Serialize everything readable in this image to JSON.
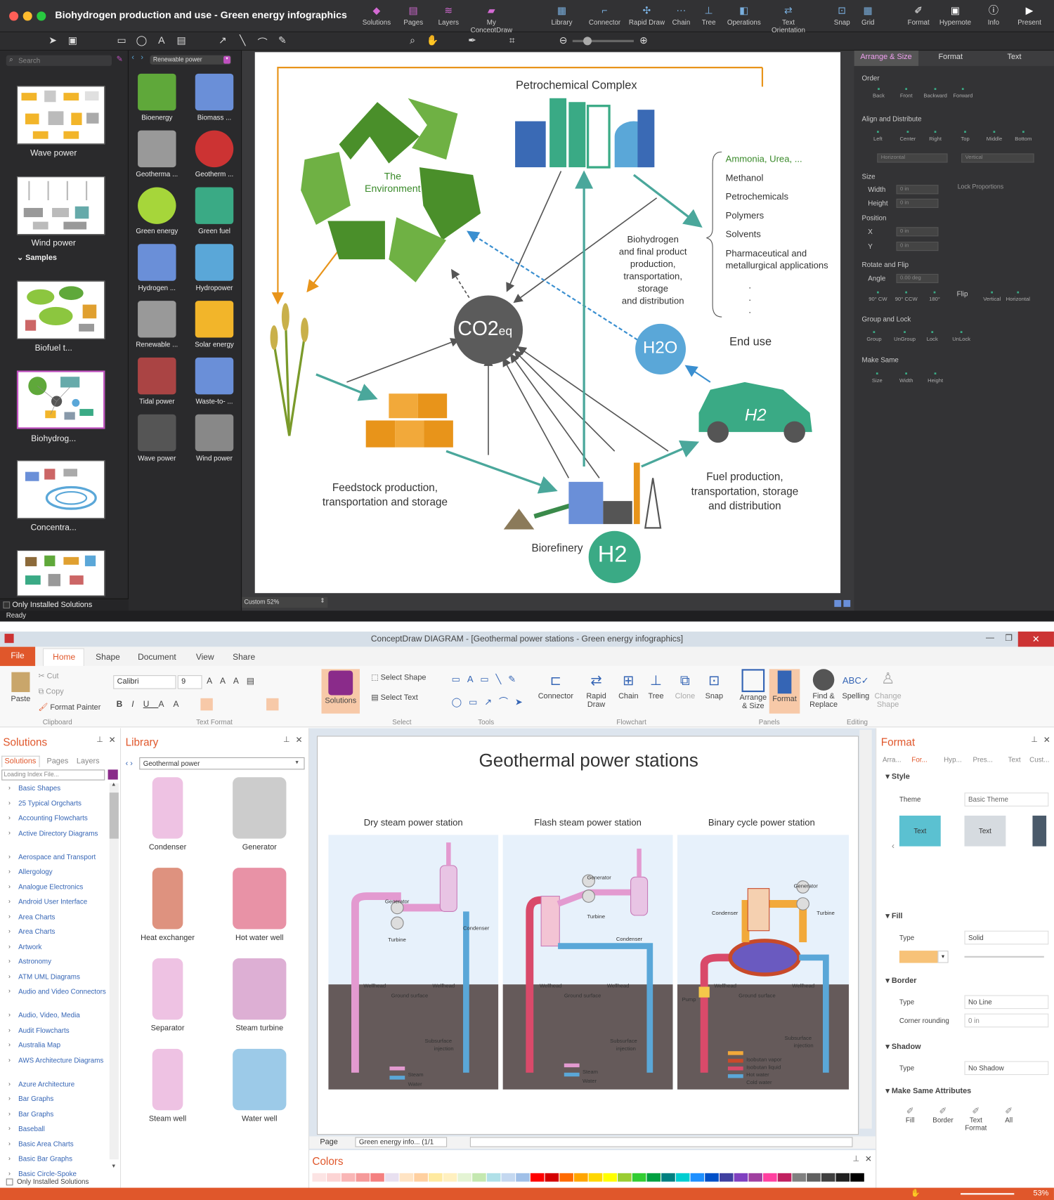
{
  "mac": {
    "title": "Biohydrogen production and use - Green energy infographics",
    "toolbar": [
      {
        "label": "Solutions",
        "icon": "diamond"
      },
      {
        "label": "Pages",
        "icon": "pages"
      },
      {
        "label": "Layers",
        "icon": "layers"
      },
      {
        "label": "My ConceptDraw",
        "icon": "folder"
      },
      {
        "label": "Library",
        "icon": "grid"
      },
      {
        "label": "Connector",
        "icon": "connector"
      },
      {
        "label": "Rapid Draw",
        "icon": "rapid"
      },
      {
        "label": "Chain",
        "icon": "chain"
      },
      {
        "label": "Tree",
        "icon": "tree"
      },
      {
        "label": "Operations",
        "icon": "ops"
      },
      {
        "label": "Text Orientation",
        "icon": "textor"
      },
      {
        "label": "Snap",
        "icon": "snap"
      },
      {
        "label": "Grid",
        "icon": "grid2"
      },
      {
        "label": "Format",
        "icon": "format"
      },
      {
        "label": "Hypernote",
        "icon": "hyper"
      },
      {
        "label": "Info",
        "icon": "info"
      },
      {
        "label": "Present",
        "icon": "play"
      }
    ],
    "search_placeholder": "Search",
    "library_select": "Renewable power",
    "thumbs": [
      "Wave power",
      "Wind power",
      "Biofuel t...",
      "Biohydrog...",
      "Concentra..."
    ],
    "samples_label": "Samples",
    "only_installed": "Only Installed Solutions",
    "status": "Ready",
    "zoom": "Custom 52%",
    "library_items": [
      "Bioenergy",
      "Biomass ...",
      "Geotherma ...",
      "Geotherm ...",
      "Green energy",
      "Green fuel",
      "Hydrogen ...",
      "Hydropower",
      "Renewable ...",
      "Solar energy",
      "Tidal power",
      "Waste-to- ...",
      "Wave power",
      "Wind power"
    ],
    "right_tabs": [
      "Arrange & Size",
      "Format",
      "Text"
    ],
    "order": {
      "title": "Order",
      "items": [
        "Back",
        "Front",
        "Backward",
        "Forward"
      ]
    },
    "align": {
      "title": "Align and Distribute",
      "items": [
        "Left",
        "Center",
        "Right",
        "Top",
        "Middle",
        "Bottom"
      ],
      "h": "Horizontal",
      "v": "Vertical"
    },
    "size": {
      "title": "Size",
      "width": "Width",
      "height": "Height",
      "w_val": "0 in",
      "h_val": "0 in",
      "lock": "Lock Proportions"
    },
    "position": {
      "title": "Position",
      "x": "X",
      "y": "Y",
      "x_val": "0 in",
      "y_val": "0 in"
    },
    "rotate": {
      "title": "Rotate and Flip",
      "angle": "Angle",
      "angle_val": "0.00 deg",
      "items": [
        "90° CW",
        "90° CCW",
        "180°"
      ],
      "flip": "Flip",
      "flip_items": [
        "Vertical",
        "Horizontal"
      ]
    },
    "group": {
      "title": "Group and Lock",
      "items": [
        "Group",
        "UnGroup",
        "Lock",
        "UnLock"
      ]
    },
    "same": {
      "title": "Make Same",
      "items": [
        "Size",
        "Width",
        "Height"
      ]
    },
    "diagram": {
      "petro": "Petrochemical Complex",
      "env": [
        "The",
        "Environment"
      ],
      "co2": "CO2",
      "co2_sub": "eq",
      "h2o": "H2O",
      "h2": "H2",
      "products": [
        "Ammonia, Urea, ...",
        "Methanol",
        "Petrochemicals",
        "Polymers",
        "Solvents",
        "Pharmaceutical and",
        "metallurgical applications"
      ],
      "bio_text": [
        "Biohydrogen",
        "and final product",
        "production,",
        "transportation,",
        "storage",
        "and distribution"
      ],
      "end_use": "End use",
      "feedstock": [
        "Feedstock production,",
        "transportation and storage"
      ],
      "fuel": [
        "Fuel production,",
        "transportation, storage",
        "and distribution"
      ],
      "biorefinery": "Biorefinery",
      "dots": [
        ".",
        ".",
        "."
      ]
    },
    "colors": {
      "green": "#3aaa85",
      "teal": "#4aa79b",
      "blue": "#5aa7d8",
      "orange": "#e8941a",
      "gray": "#5b5b5b",
      "accent": "#c050c0"
    }
  },
  "win": {
    "title": "ConceptDraw DIAGRAM - [Geothermal power stations - Green energy infographics]",
    "file": "File",
    "tabs": [
      "Home",
      "Shape",
      "Document",
      "View",
      "Share"
    ],
    "clipboard": {
      "paste": "Paste",
      "cut": "Cut",
      "copy": "Copy",
      "painter": "Format Painter",
      "label": "Clipboard"
    },
    "font": "Calibri",
    "font_size": "9",
    "text_format": "Text Format",
    "solutions_btn": "Solutions",
    "select": {
      "shape": "Select Shape",
      "text": "Select Text",
      "label": "Select"
    },
    "tools_label": "Tools",
    "flow": [
      "Connector",
      "Rapid Draw",
      "Chain",
      "Tree",
      "Clone",
      "Snap"
    ],
    "flow_label": "Flowchart",
    "panels": [
      "Arrange & Size",
      "Format"
    ],
    "panels_label": "Panels",
    "editing": [
      "Find & Replace",
      "Spelling",
      "Change Shape"
    ],
    "editing_label": "Editing",
    "solutions_panel": "Solutions",
    "sol_tabs": [
      "Solutions",
      "Pages",
      "Layers"
    ],
    "loading": "Loading Index File...",
    "sol_list": [
      "Basic Shapes",
      "25 Typical Orgcharts",
      "Accounting Flowcharts",
      "Active Directory Diagrams",
      "Aerospace and Transport",
      "Allergology",
      "Analogue Electronics",
      "Android User Interface",
      "Area Charts",
      "Area Charts",
      "Artwork",
      "Astronomy",
      "ATM UML Diagrams",
      "Audio and Video Connectors",
      "Audio, Video, Media",
      "Audit Flowcharts",
      "Australia Map",
      "AWS Architecture Diagrams",
      "Azure Architecture",
      "Bar Graphs",
      "Bar Graphs",
      "Baseball",
      "Basic Area Charts",
      "Basic Bar Graphs",
      "Basic Circle-Spoke"
    ],
    "only_installed": "Only Installed Solutions",
    "library_panel": "Library",
    "library_select": "Geothermal power",
    "library_items": [
      "Condenser",
      "Generator",
      "Heat exchanger",
      "Hot water well",
      "Separator",
      "Steam turbine",
      "Steam well",
      "Water well"
    ],
    "page_title": "Geothermal power stations",
    "stations": [
      "Dry steam power station",
      "Flash steam power station",
      "Binary cycle power station"
    ],
    "labels": {
      "generator": "Generator",
      "turbine": "Turbine",
      "condenser": "Condenser",
      "wellhead": "Wellhead",
      "ground": "Ground surface",
      "subsurface": "Subsurface",
      "injection": "injection",
      "pump": "Pump"
    },
    "legend1": [
      "Steam",
      "Water"
    ],
    "legend3": [
      "Isobutan vapor",
      "Isobutan liquid",
      "Hot water",
      "Cold water"
    ],
    "page_label": "Page",
    "page_select": "Green energy info... (1/1",
    "colors_label": "Colors",
    "format_panel": "Format",
    "fmt_tabs": [
      "Arra...",
      "For...",
      "Hyp...",
      "Pres...",
      "Text",
      "Cust..."
    ],
    "style": "Style",
    "theme": "Theme",
    "theme_val": "Basic Theme",
    "text_sample": "Text",
    "fill": "Fill",
    "type": "Type",
    "fill_val": "Solid",
    "border": "Border",
    "border_val": "No Line",
    "corner": "Corner rounding",
    "corner_val": "0 in",
    "shadow": "Shadow",
    "shadow_val": "No Shadow",
    "same": "Make Same Attributes",
    "same_items": [
      "Fill",
      "Border",
      "Text Format",
      "All"
    ],
    "zoom": "53%"
  }
}
